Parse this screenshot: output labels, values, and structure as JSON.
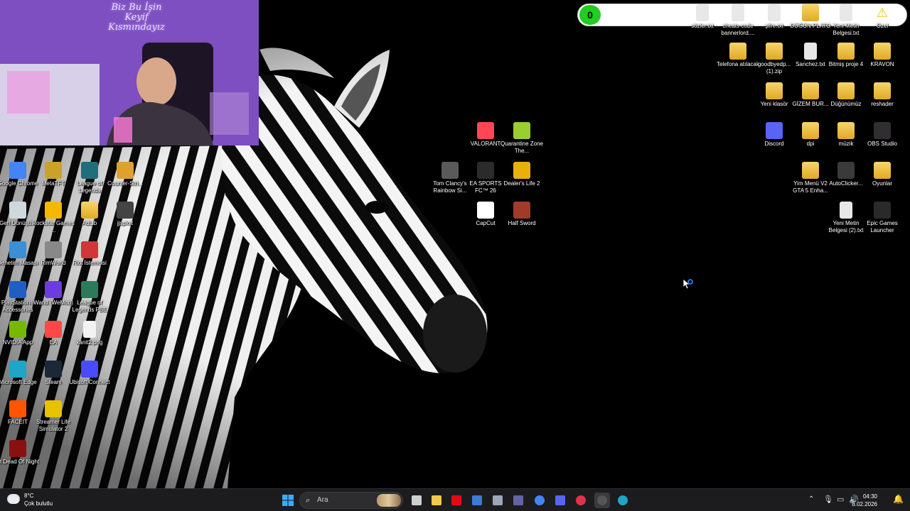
{
  "webcam": {
    "sign_text": "Biz Bu İşin Keyif Kısmındayız"
  },
  "top_bar": {
    "counter": "0",
    "items": [
      {
        "label": "sözler.txt",
        "icon": "text-file-icon"
      },
      {
        "label": "cheats code bannerlord....",
        "icon": "text-file-icon"
      },
      {
        "label": "şifre.txt",
        "icon": "text-file-icon"
      },
      {
        "label": "DÜĞÜN PLATO",
        "icon": "folder-icon"
      },
      {
        "label": "Yeni Metin Belgesi.txt",
        "icon": "text-file-icon"
      },
      {
        "label": "Özel",
        "icon": "warning-icon"
      }
    ]
  },
  "desktop_left": [
    {
      "label": "Google Chrome",
      "icon": "chrome-icon",
      "color": "#4285f4"
    },
    {
      "label": "MetaTFT",
      "icon": "metatft-icon",
      "color": "#c9a227"
    },
    {
      "label": "League of Legends",
      "icon": "league-icon",
      "color": "#1f6f7a"
    },
    {
      "label": "Counter-Stri...",
      "icon": "counter-strike-icon",
      "color": "#e0a030"
    },
    {
      "label": "Geri Dönüşü...",
      "icon": "recycle-bin-icon",
      "color": "#cfd8dc"
    },
    {
      "label": "Rockstar Games ...",
      "icon": "rockstar-icon",
      "color": "#f5b700"
    },
    {
      "label": "AdLib",
      "icon": "folder-icon",
      "color": "#f2c94c"
    },
    {
      "label": "jjsploit",
      "icon": "jjsploit-icon",
      "color": "#444444"
    },
    {
      "label": "Denetim Masası",
      "icon": "control-panel-icon",
      "color": "#3a8fd6"
    },
    {
      "label": "RimWorld",
      "icon": "rimworld-icon",
      "color": "#888888"
    },
    {
      "label": "Riot İstemcisi",
      "icon": "riot-icon",
      "color": "#d13639"
    },
    {
      "label": "PlayStation® Accessories",
      "icon": "playstation-icon",
      "color": "#1f5fc4"
    },
    {
      "label": "Wand (WeMod)",
      "icon": "wemod-icon",
      "color": "#6c3ce0"
    },
    {
      "label": "League of Legends PBE",
      "icon": "league-pbe-icon",
      "color": "#2c7a5a"
    },
    {
      "label": "NVIDIA App",
      "icon": "nvidia-icon",
      "color": "#76b900"
    },
    {
      "label": "EA",
      "icon": "ea-icon",
      "color": "#ff4747"
    },
    {
      "label": "kanit2.png",
      "icon": "image-file-icon",
      "color": "#e0e0e0"
    },
    {
      "label": "Microsoft Edge",
      "icon": "edge-icon",
      "color": "#1fa5c7"
    },
    {
      "label": "Steam",
      "icon": "steam-icon",
      "color": "#1b2838"
    },
    {
      "label": "Ubisoft Connect",
      "icon": "ubisoft-icon",
      "color": "#4a4aff"
    },
    {
      "label": "FACEIT",
      "icon": "faceit-icon",
      "color": "#ff5500"
    },
    {
      "label": "Streamer Life Simulator 2",
      "icon": "streamer-life-icon",
      "color": "#e6c200"
    },
    {
      "label": "At Dead Of Night",
      "icon": "at-dead-of-night-icon",
      "color": "#8a1010"
    }
  ],
  "desktop_middle": [
    {
      "label": "VALORANT",
      "icon": "valorant-icon",
      "color": "#ff4655"
    },
    {
      "label": "Quarantine Zone The...",
      "icon": "quarantine-zone-icon",
      "color": "#9acd32"
    },
    {
      "label": "Tom Clancy's Rainbow Si...",
      "icon": "rainbow-six-icon",
      "color": "#5a5a5a"
    },
    {
      "label": "EA SPORTS FC™ 26",
      "icon": "ea-fc-icon",
      "color": "#2b2b2b"
    },
    {
      "label": "Dealer's Life 2",
      "icon": "dealers-life-icon",
      "color": "#e7b10a"
    },
    {
      "label": "CapCut",
      "icon": "capcut-icon",
      "color": "#ffffff"
    },
    {
      "label": "Half Sword",
      "icon": "half-sword-icon",
      "color": "#a23a2a"
    }
  ],
  "desktop_right": [
    {
      "label": "Telefona atılacak",
      "icon": "folder-icon"
    },
    {
      "label": "goodbyedp... (1).zip",
      "icon": "zip-folder-icon"
    },
    {
      "label": "Sanchez.txt",
      "icon": "text-file-icon"
    },
    {
      "label": "Bitmiş proje 4",
      "icon": "folder-icon"
    },
    {
      "label": "KRAVON",
      "icon": "folder-icon"
    },
    {
      "label": "Yeni klasör",
      "icon": "folder-icon"
    },
    {
      "label": "GİZEM BUR...",
      "icon": "folder-icon"
    },
    {
      "label": "Düğünümüz",
      "icon": "folder-icon"
    },
    {
      "label": "reshader",
      "icon": "folder-icon"
    },
    {
      "label": "Discord",
      "icon": "discord-icon"
    },
    {
      "label": "dpi",
      "icon": "folder-icon"
    },
    {
      "label": "müzik",
      "icon": "folder-icon"
    },
    {
      "label": "OBS Studio",
      "icon": "obs-icon"
    },
    {
      "label": "Yim Menü V2 GTA 5 Enha...",
      "icon": "folder-icon"
    },
    {
      "label": "AutoClicker...",
      "icon": "mouse-icon"
    },
    {
      "label": "Oyunlar",
      "icon": "folder-icon"
    },
    {
      "label": "Yeni Metin Belgesi (2).txt",
      "icon": "text-file-icon"
    },
    {
      "label": "Epic Games Launcher",
      "icon": "epic-games-icon"
    }
  ],
  "taskbar": {
    "weather": {
      "temperature": "8°C",
      "condition": "Çok bulutlu"
    },
    "search_placeholder": "Ara",
    "apps": [
      "task-view-icon",
      "file-explorer-icon",
      "netflix-icon",
      "microsoft-store-icon",
      "app-icon",
      "teams-icon",
      "chrome-icon",
      "discord-icon",
      "redirect-icon",
      "obs-icon",
      "browser-icon"
    ],
    "clock": {
      "time": "04:30",
      "date": "8.02.2026"
    }
  }
}
